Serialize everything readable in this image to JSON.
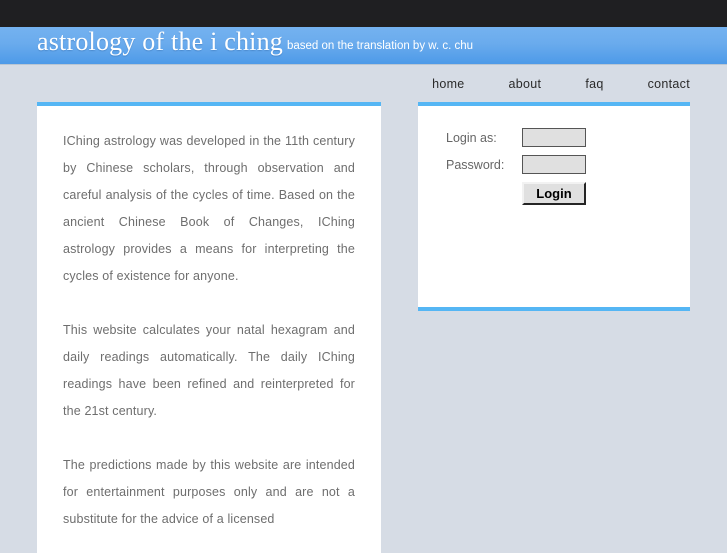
{
  "header": {
    "title": "astrology of the i ching",
    "subtitle": "based on the translation by w. c. chu"
  },
  "nav": {
    "items": [
      {
        "label": "home"
      },
      {
        "label": "about"
      },
      {
        "label": "faq"
      },
      {
        "label": "contact"
      }
    ]
  },
  "main": {
    "paragraphs": [
      "IChing astrology was developed in the 11th century by Chinese scholars, through observation and careful analysis of the cycles of time. Based on the ancient Chinese Book of Changes, IChing astrology provides a means for interpreting the cycles of existence for anyone.",
      "This website calculates your natal hexagram and daily readings automatically. The daily IChing readings have been refined and reinterpreted for the 21st century.",
      "The predictions made by this website are intended for entertainment purposes only and are not a substitute for the advice of a licensed"
    ]
  },
  "login": {
    "username_label": "Login as:",
    "username_value": "",
    "username_placeholder": "",
    "password_label": "Password:",
    "password_value": "",
    "password_placeholder": "",
    "submit_label": "Login"
  },
  "colors": {
    "accent": "#55b6f4",
    "banner_top": "#74b2f0",
    "banner_bottom": "#4d9ae8",
    "page_background": "#d6dce5",
    "topbar": "#1f1f22",
    "body_text": "#6e6e6e"
  }
}
